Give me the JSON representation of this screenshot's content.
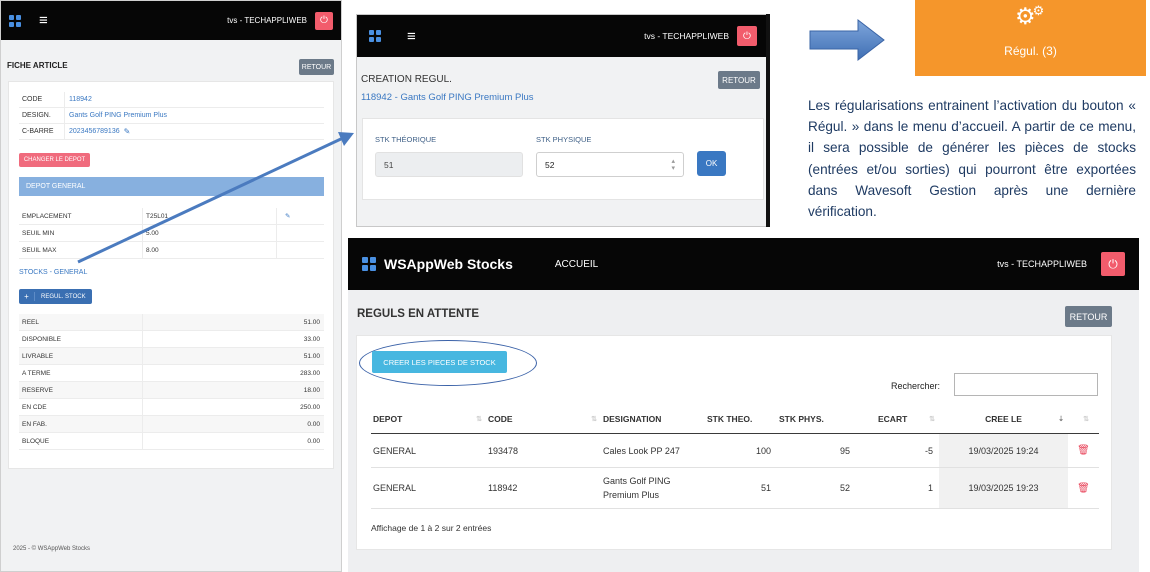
{
  "fiche": {
    "user": "tvs - TECHAPPLIWEB",
    "title": "FICHE ARTICLE",
    "retour": "RETOUR",
    "rows": [
      {
        "k": "CODE",
        "v": "118942"
      },
      {
        "k": "DESIGN.",
        "v": "Gants Golf PING Premium Plus"
      },
      {
        "k": "C-BARRE",
        "v": "2023456789136"
      }
    ],
    "change_depot": "CHANGER LE DEPOT",
    "depot": "DEPOT GENERAL",
    "depot_rows": [
      {
        "k": "EMPLACEMENT",
        "v": "T25L01"
      },
      {
        "k": "SEUIL MIN",
        "v": "5.00"
      },
      {
        "k": "SEUIL MAX",
        "v": "8.00"
      }
    ],
    "stocks_link": "STOCKS - GENERAL",
    "regul_stock_btn": "REGUL. STOCK",
    "stocks": [
      {
        "k": "REEL",
        "v": "51.00"
      },
      {
        "k": "DISPONIBLE",
        "v": "33.00"
      },
      {
        "k": "LIVRABLE",
        "v": "51.00"
      },
      {
        "k": "A TERME",
        "v": "283.00"
      },
      {
        "k": "RESERVE",
        "v": "18.00"
      },
      {
        "k": "EN CDE",
        "v": "250.00"
      },
      {
        "k": "EN FAB.",
        "v": "0.00"
      },
      {
        "k": "BLOQUE",
        "v": "0.00"
      }
    ],
    "footer": "2025 - © WSAppWeb Stocks"
  },
  "creation": {
    "user": "tvs - TECHAPPLIWEB",
    "title": "CREATION REGUL.",
    "subtitle": "118942 - Gants Golf PING Premium Plus",
    "retour": "RETOUR",
    "stk_theo_label": "STK THÉORIQUE",
    "stk_theo_value": "51",
    "stk_phys_label": "STK PHYSIQUE",
    "stk_phys_value": "52",
    "ok": "OK"
  },
  "tile": {
    "label": "Régul. (3)",
    "color": "#f5962b",
    "icon": "gears-icon"
  },
  "explanation": "Les régularisations entrainent l’activation du bouton « Régul. » dans le menu d’accueil. A partir de ce menu, il sera possible de générer les pièces de stocks (entrées et/ou sorties) qui pourront être exportées dans Wavesoft Gestion après une dernière vérification.",
  "reguls": {
    "brand": "WSAppWeb Stocks",
    "nav_accueil": "ACCUEIL",
    "user": "tvs - TECHAPPLIWEB",
    "title": "REGULS EN ATTENTE",
    "retour": "RETOUR",
    "creer_btn": "CREER LES PIECES DE STOCK",
    "search_label": "Rechercher:",
    "search_value": "",
    "columns": [
      "DEPOT",
      "CODE",
      "DESIGNATION",
      "STK THEO.",
      "STK PHYS.",
      "ECART",
      "CREE LE"
    ],
    "rows": [
      {
        "depot": "GENERAL",
        "code": "193478",
        "designation": "Cales Look PP 247",
        "theo": "100",
        "phys": "95",
        "ecart": "-5",
        "date": "19/03/2025 19:24"
      },
      {
        "depot": "GENERAL",
        "code": "118942",
        "designation": "Gants Golf PING Premium Plus",
        "theo": "51",
        "phys": "52",
        "ecart": "1",
        "date": "19/03/2025 19:23"
      }
    ],
    "info": "Affichage de 1 à 2 sur 2 entrées"
  },
  "colors": {
    "accent_blue": "#3a78c2",
    "logout_red": "#f25c6c",
    "info_blue": "#47b7e0"
  }
}
